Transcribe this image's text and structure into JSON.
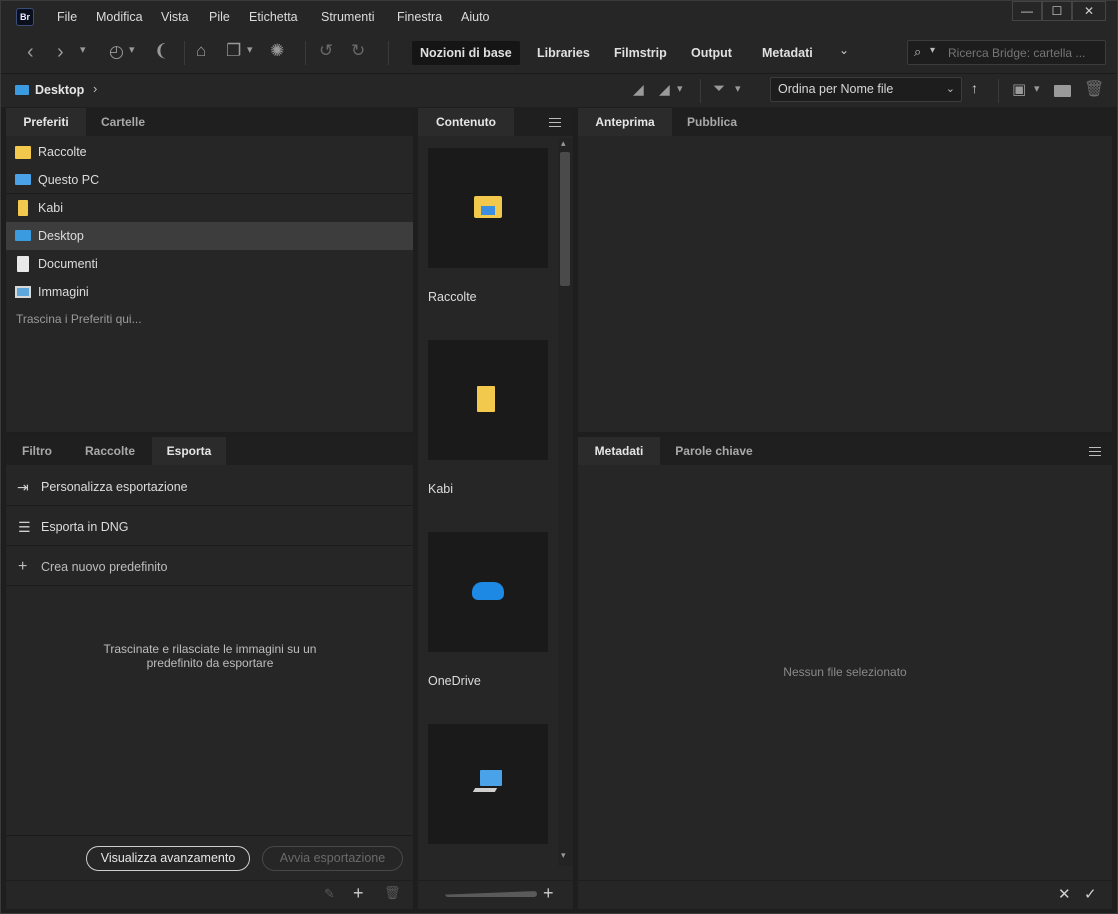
{
  "app": {
    "logo": "Br"
  },
  "menu": [
    "File",
    "Modifica",
    "Vista",
    "Pile",
    "Etichetta",
    "Strumenti",
    "Finestra",
    "Aiuto"
  ],
  "window_controls": {
    "minimize": "—",
    "maximize": "☐",
    "close": "✕"
  },
  "toolbar": {
    "workspaces": [
      "Nozioni di base",
      "Libraries",
      "Filmstrip",
      "Output",
      "Metadati"
    ],
    "active_workspace": "Nozioni di base",
    "search_placeholder": "Ricerca Bridge: cartella ...",
    "icons": [
      "back-icon",
      "forward-icon",
      "recent-icon",
      "boomerang-icon",
      "camera-import-icon",
      "copy-icon",
      "refine-icon",
      "rotate-left-icon",
      "rotate-right-icon",
      "more-workspaces-icon",
      "search-icon"
    ]
  },
  "pathbar": {
    "location": "Desktop",
    "sort_label": "Ordina per Nome file"
  },
  "favorites_panel": {
    "tabs": [
      "Preferiti",
      "Cartelle"
    ],
    "items": [
      {
        "label": "Raccolte",
        "icon": "collections-folder-icon"
      },
      {
        "label": "Questo PC",
        "icon": "this-pc-icon"
      },
      {
        "label": "Kabi",
        "icon": "folder-icon"
      },
      {
        "label": "Desktop",
        "icon": "desktop-icon",
        "selected": true
      },
      {
        "label": "Documenti",
        "icon": "documents-icon"
      },
      {
        "label": "Immagini",
        "icon": "pictures-icon"
      }
    ],
    "drop_hint": "Trascina i Preferiti qui..."
  },
  "export_panel": {
    "tabs": [
      "Filtro",
      "Raccolte",
      "Esporta"
    ],
    "items": [
      {
        "label": "Personalizza esportazione",
        "icon": "export-icon"
      },
      {
        "label": "Esporta in DNG",
        "icon": "list-icon"
      },
      {
        "label": "Crea nuovo predefinito",
        "icon": "plus-icon"
      }
    ],
    "drop_hint": "Trascinate e rilasciate le immagini su un predefinito da esportare",
    "show_progress": "Visualizza avanzamento",
    "start_export": "Avvia esportazione"
  },
  "content_panel": {
    "tab": "Contenuto",
    "items": [
      {
        "label": "Raccolte",
        "icon": "collections-folder-icon"
      },
      {
        "label": "Kabi",
        "icon": "folder-icon"
      },
      {
        "label": "OneDrive",
        "icon": "onedrive-icon"
      },
      {
        "label": "",
        "icon": "this-pc-icon"
      }
    ]
  },
  "preview_panel": {
    "tabs": [
      "Anteprima",
      "Pubblica"
    ]
  },
  "metadata_panel": {
    "tabs": [
      "Metadati",
      "Parole chiave"
    ],
    "empty_message": "Nessun file selezionato"
  },
  "colors": {
    "accent_desktop": "#3a9be0",
    "folder_yellow": "#f2c94c",
    "onedrive_blue": "#1e88e5"
  }
}
